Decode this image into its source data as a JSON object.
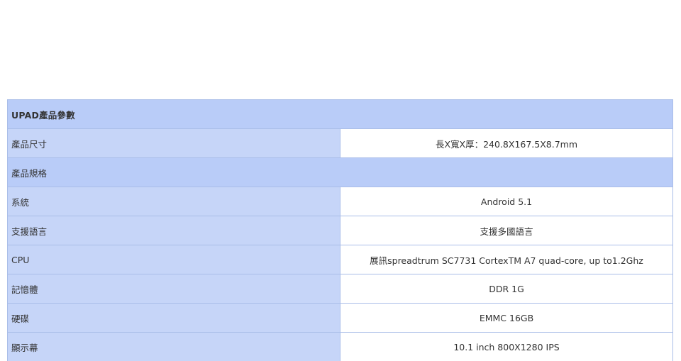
{
  "table": {
    "title": "UPAD產品參數",
    "rows": [
      {
        "kind": "spec",
        "label": "產品尺寸",
        "value": "長X寬X厚：240.8X167.5X8.7mm"
      },
      {
        "kind": "section",
        "label": "產品規格"
      },
      {
        "kind": "spec",
        "label": "系統",
        "value": "Android 5.1"
      },
      {
        "kind": "spec",
        "label": "支援語言",
        "value": "支援多國語言"
      },
      {
        "kind": "spec",
        "label": "CPU",
        "value": "展訊spreadtrum SC7731 CortexTM A7 quad-core, up to1.2Ghz"
      },
      {
        "kind": "spec",
        "label": "記憶體",
        "value": "DDR 1G"
      },
      {
        "kind": "spec",
        "label": "硬碟",
        "value": "EMMC 16GB"
      },
      {
        "kind": "spec",
        "label": "顯示幕",
        "value": "10.1 inch 800X1280 IPS"
      }
    ]
  },
  "colors": {
    "header_bg": "#b9ccf8",
    "label_bg": "#c6d5f8",
    "border": "#a9bde8",
    "value_bg": "#ffffff"
  }
}
